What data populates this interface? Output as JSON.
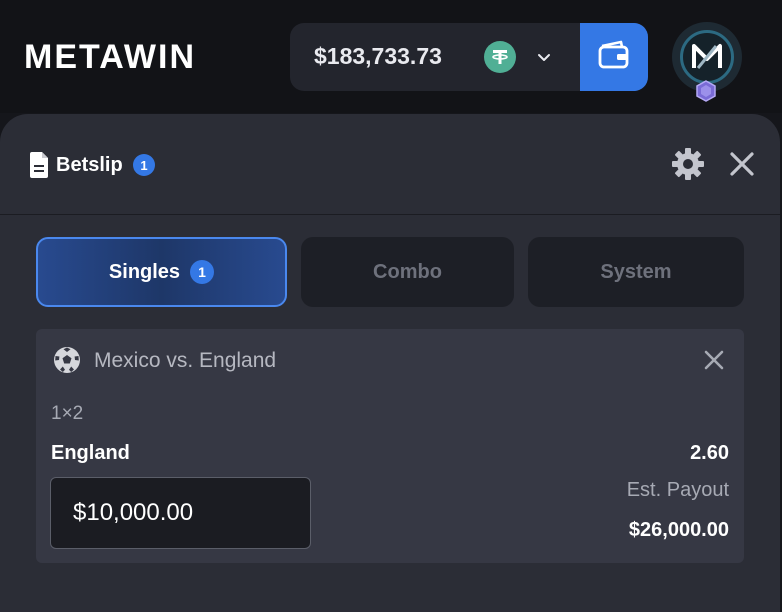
{
  "header": {
    "logo": "METAWIN",
    "balance": "$183,733.73",
    "currency_icon": "tether-icon",
    "dropdown_icon": "chevron-down-icon",
    "wallet_icon": "wallet-icon",
    "avatar_icon": "metawin-avatar-icon"
  },
  "betslip": {
    "title": "Betslip",
    "count": "1",
    "tabs": [
      {
        "label": "Singles",
        "badge": "1",
        "active": true
      },
      {
        "label": "Combo",
        "active": false
      },
      {
        "label": "System",
        "active": false
      }
    ],
    "bet": {
      "match": "Mexico vs. England",
      "market": "1×2",
      "selection": "England",
      "odds": "2.60",
      "stake": "$10,000.00",
      "payout_label": "Est. Payout",
      "payout": "$26,000.00"
    }
  },
  "colors": {
    "accent": "#3478e5",
    "panel": "#2b2d36",
    "card": "#363844",
    "tether": "#50af95"
  }
}
